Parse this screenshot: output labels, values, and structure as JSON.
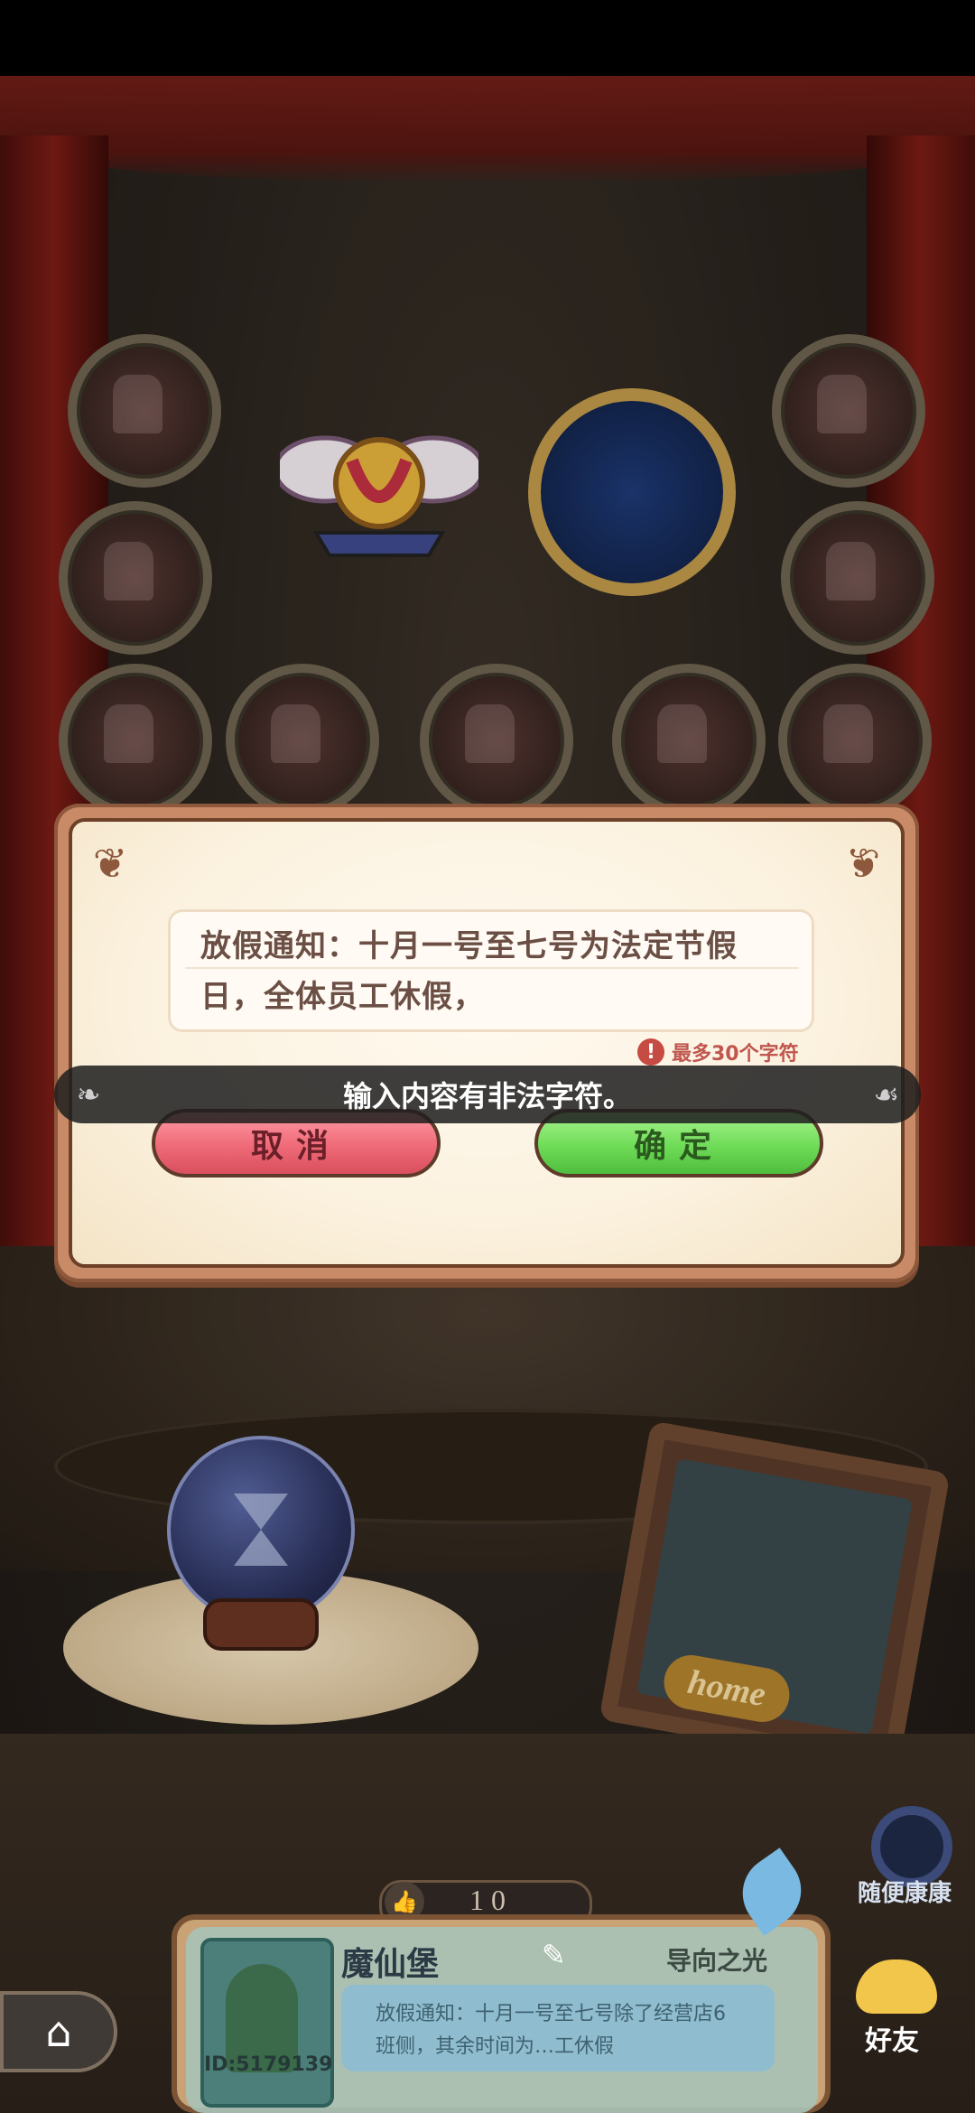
{
  "dialog": {
    "input_line1": "放假通知：十月一号至七号为法定节假",
    "input_line2": "日，全体员工休假，",
    "limit_icon": "warning-icon",
    "limit_text": "最多30个字符",
    "cancel_label": "取消",
    "confirm_label": "确定",
    "colors": {
      "cancel": "#ef6a78",
      "confirm": "#6fdc58",
      "frame": "#c98b67"
    }
  },
  "toast": {
    "message": "输入内容有非法字符。"
  },
  "scene": {
    "frame_label": "home",
    "hourglass_icon": "hourglass-icon"
  },
  "likes": {
    "icon": "thumbs-up-icon",
    "count": "10"
  },
  "profile": {
    "name": "魔仙堡",
    "title": "导向之光",
    "id_text": "ID:5179139",
    "note_line1": "放假通知：十月一号至七号除了经营店6",
    "note_line2": "班侧，其余时间为…工休假"
  },
  "nav": {
    "home_icon": "home-icon",
    "portal_label": "随便康康",
    "friends_label": "好友"
  }
}
